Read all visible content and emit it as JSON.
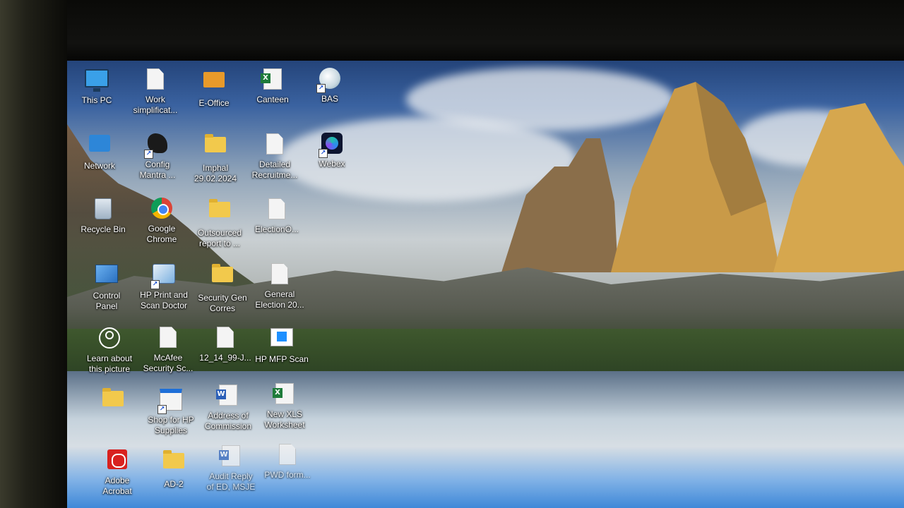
{
  "desktop": {
    "icons": [
      {
        "id": "this-pc",
        "label": "This PC",
        "glyph": "monitor-icon"
      },
      {
        "id": "work",
        "label": "Work\nsimplificat...",
        "glyph": "document-icon"
      },
      {
        "id": "e-office",
        "label": "E-Office",
        "glyph": "folder-icon"
      },
      {
        "id": "canteen",
        "label": "Canteen",
        "glyph": "excel-icon"
      },
      {
        "id": "bas",
        "label": "BAS",
        "glyph": "bas-icon"
      },
      {
        "id": "network",
        "label": "Network",
        "glyph": "network-icon"
      },
      {
        "id": "config-mantra",
        "label": "Config\nMantra ...",
        "glyph": "config-icon"
      },
      {
        "id": "imphal",
        "label": "Imphal\n29.02.2024",
        "glyph": "folder-icon"
      },
      {
        "id": "detailed-recruitment",
        "label": "Detailed\nRecruitme...",
        "glyph": "document-icon"
      },
      {
        "id": "webex",
        "label": "Webex",
        "glyph": "webex-icon"
      },
      {
        "id": "recycle-bin",
        "label": "Recycle Bin",
        "glyph": "recycle-bin-icon"
      },
      {
        "id": "google-chrome",
        "label": "Google\nChrome",
        "glyph": "chrome-icon"
      },
      {
        "id": "outsourced-report",
        "label": "Outsourced\nreport to ...",
        "glyph": "folder-icon"
      },
      {
        "id": "election-o",
        "label": "ElectionO...",
        "glyph": "document-icon"
      },
      {
        "id": "control-panel",
        "label": "Control\nPanel",
        "glyph": "control-panel-icon"
      },
      {
        "id": "hp-print-scan-doctor",
        "label": "HP Print and\nScan Doctor",
        "glyph": "hp-print-icon"
      },
      {
        "id": "security-gen-corres",
        "label": "Security Gen\nCorres",
        "glyph": "folder-icon"
      },
      {
        "id": "general-election",
        "label": "General\nElection 20...",
        "glyph": "document-icon"
      },
      {
        "id": "learn-about-picture",
        "label": "Learn about\nthis picture",
        "glyph": "learn-icon"
      },
      {
        "id": "mcafee",
        "label": "McAfee\nSecurity Sc...",
        "glyph": "document-icon"
      },
      {
        "id": "file-12-14-99",
        "label": "12_14_99-J...",
        "glyph": "document-icon"
      },
      {
        "id": "hp-mfp-scan",
        "label": "HP MFP Scan",
        "glyph": "hp-scan-icon"
      },
      {
        "id": "folder-unnamed",
        "label": "",
        "glyph": "folder-icon"
      },
      {
        "id": "shop-for-hp-supplies",
        "label": "Shop for HP\nSupplies",
        "glyph": "shop-icon"
      },
      {
        "id": "address-of-commission",
        "label": "Address of\nCommission",
        "glyph": "word-icon"
      },
      {
        "id": "new-xls-worksheet",
        "label": "New XLS\nWorksheet",
        "glyph": "excel-icon"
      },
      {
        "id": "adobe-acrobat",
        "label": "Adobe\nAcrobat",
        "glyph": "pdf-icon"
      },
      {
        "id": "ad-2",
        "label": "AD-2",
        "glyph": "folder-icon"
      },
      {
        "id": "audit-reply",
        "label": "Audit Reply\nof ED, MSJE",
        "glyph": "word-icon"
      },
      {
        "id": "pwd-form",
        "label": "PWD form...",
        "glyph": "document-icon"
      }
    ]
  }
}
